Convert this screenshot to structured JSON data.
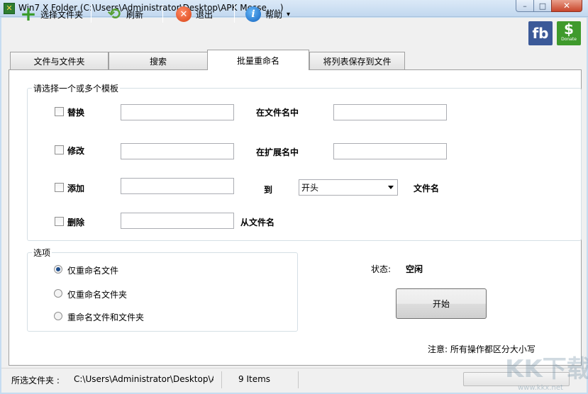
{
  "window": {
    "title": "Win7 X Folder (C:\\Users\\Administrator\\Desktop\\APK Messe.....)"
  },
  "window_buttons": {
    "minimize": "–",
    "maximize": "□",
    "close": "✕"
  },
  "toolbar": {
    "select_folder": "选择文件夹",
    "refresh": "刷新",
    "exit": "退出",
    "help": "帮助",
    "help_arrow": "▾",
    "facebook": "fb",
    "donate_symbol": "$",
    "donate_text": "Donate"
  },
  "icons": {
    "add": "plus-icon",
    "refresh": "refresh-icon",
    "exit": "exit-icon",
    "help": "info-icon"
  },
  "tabs": [
    {
      "label": "文件与文件夹"
    },
    {
      "label": "搜索"
    },
    {
      "label": "批量重命名"
    },
    {
      "label": "将列表保存到文件"
    }
  ],
  "templates": {
    "legend": "请选择一个或多个模板",
    "replace": {
      "label": "替换",
      "field1": "",
      "middle": "在文件名中",
      "field2": "",
      "checked": false
    },
    "modify": {
      "label": "修改",
      "field1": "",
      "middle": "在扩展名中",
      "field2": "",
      "checked": false
    },
    "add": {
      "label": "添加",
      "field1": "",
      "middle": "到",
      "position": "开头",
      "suffix": "文件名",
      "checked": false
    },
    "delete": {
      "label": "删除",
      "field1": "",
      "suffix": "从文件名",
      "checked": false
    }
  },
  "options": {
    "legend": "选项",
    "items": [
      {
        "label": "仅重命名文件",
        "selected": true
      },
      {
        "label": "仅重命名文件夹",
        "selected": false
      },
      {
        "label": "重命名文件和文件夹",
        "selected": false
      }
    ]
  },
  "status": {
    "label": "状态:",
    "value": "空闲"
  },
  "start_button": "开始",
  "note": "注意: 所有操作都区分大小写",
  "statusbar": {
    "selected_folder_label": "所选文件夹 :",
    "selected_folder_path": "C:\\Users\\Administrator\\Desktop\\A",
    "items": "9 Items"
  },
  "watermark": {
    "main": "KK下载",
    "url": "www.kkx.net"
  },
  "colors": {
    "accent": "#1f4e8c",
    "title_bg": "#c2d8ef",
    "close": "#c8452b"
  }
}
